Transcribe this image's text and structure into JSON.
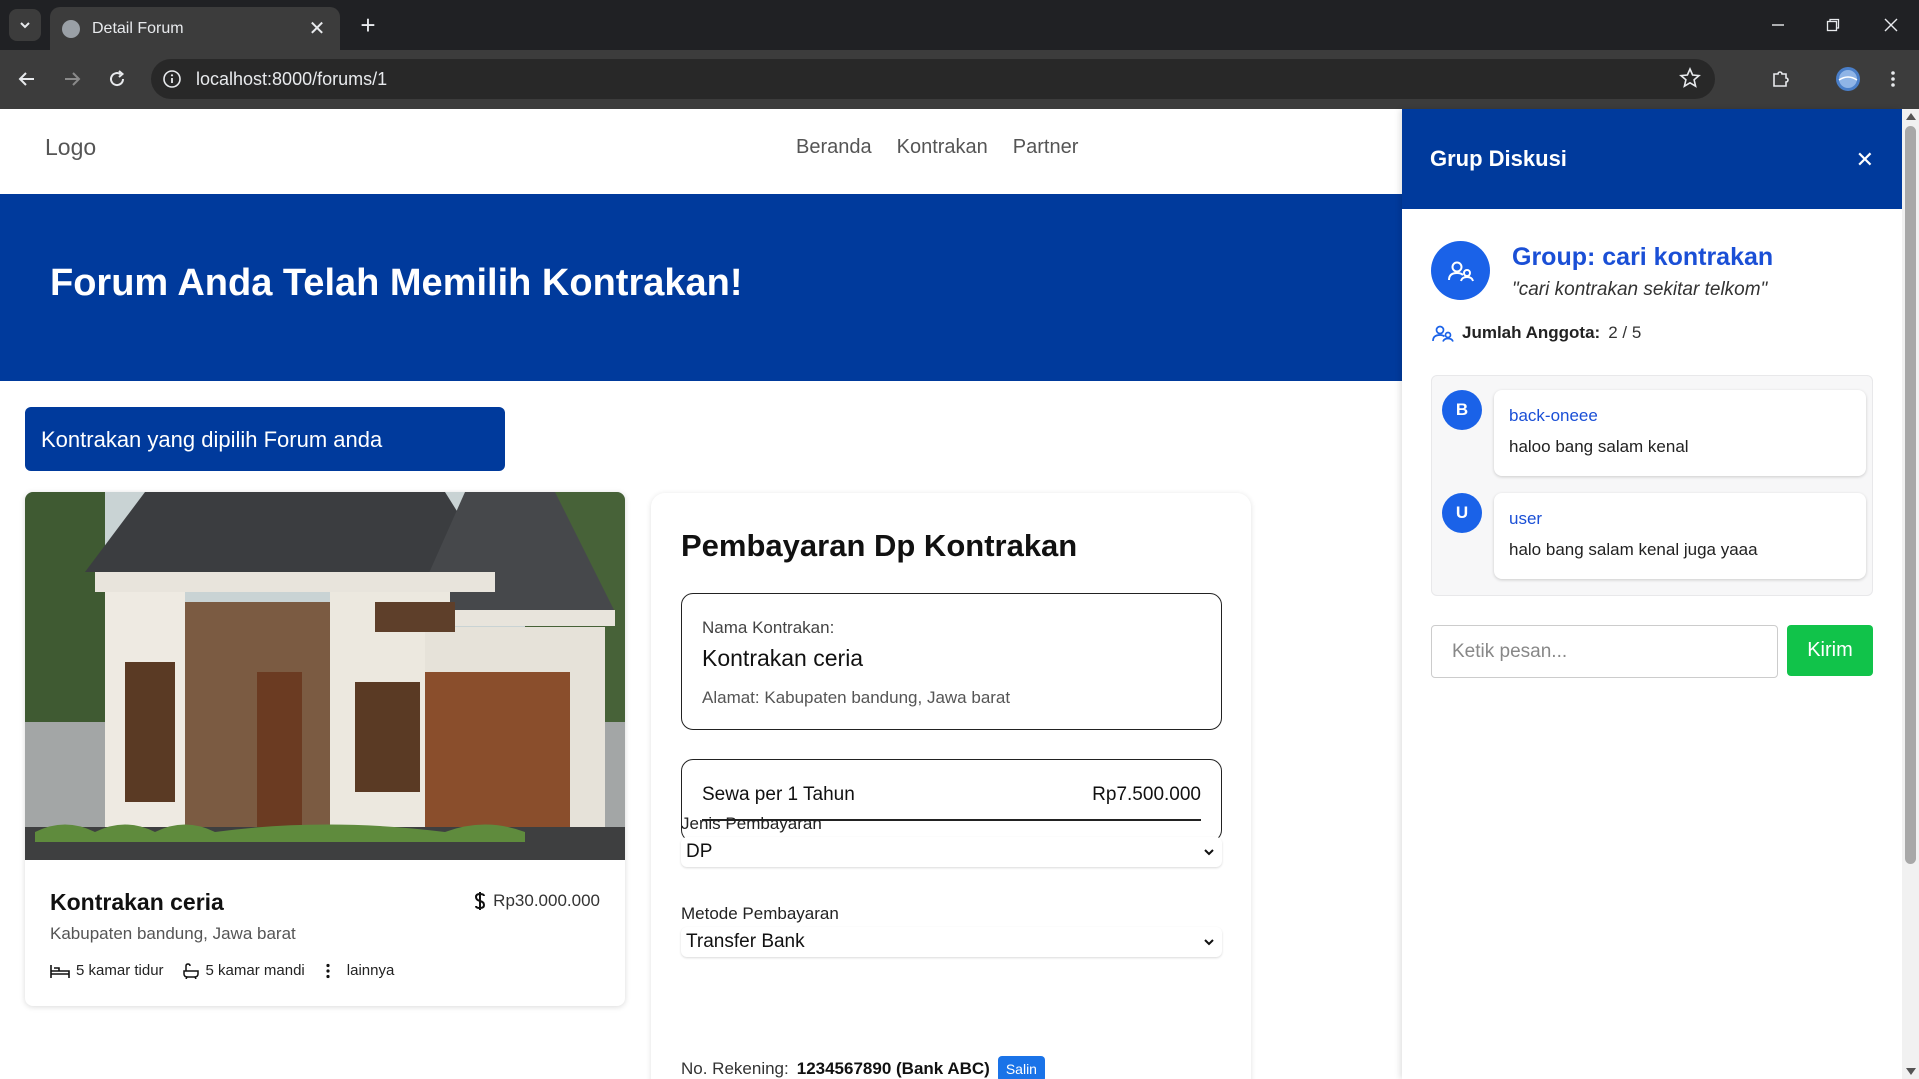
{
  "browser": {
    "tab_title": "Detail Forum",
    "url": "localhost:8000/forums/1",
    "new_tab": "+",
    "tab_close": "✕"
  },
  "navbar": {
    "logo": "Logo",
    "links": [
      "Beranda",
      "Kontrakan",
      "Partner"
    ]
  },
  "hero": {
    "title": "Forum Anda Telah Memilih Kontrakan!"
  },
  "section_badge": "Kontrakan yang dipilih Forum anda",
  "listing": {
    "name": "Kontrakan ceria",
    "price": "Rp30.000.000",
    "address": "Kabupaten bandung, Jawa barat",
    "features": [
      "5 kamar tidur",
      "5 kamar mandi",
      "lainnya"
    ]
  },
  "payment": {
    "title": "Pembayaran Dp Kontrakan",
    "name_label": "Nama Kontrakan:",
    "name_value": "Kontrakan ceria",
    "address": "Alamat: Kabupaten bandung, Jawa barat",
    "rent_label": "Sewa per 1 Tahun",
    "rent_value": "Rp7.500.000",
    "type_label": "Jenis Pembayaran",
    "type_value": "DP",
    "method_label": "Metode Pembayaran",
    "method_value": "Transfer Bank",
    "account_label": "No. Rekening:",
    "account_value": "1234567890 (Bank ABC)",
    "copy_label": "Salin"
  },
  "chat_panel": {
    "title": "Grup Diskusi",
    "close": "✕",
    "group_name": "Group: cari kontrakan",
    "group_desc": "\"cari kontrakan sekitar telkom\"",
    "members_label": "Jumlah Anggota:",
    "members_value": "2 / 5",
    "messages": [
      {
        "initial": "B",
        "user": "back-oneee",
        "text": "haloo bang salam kenal"
      },
      {
        "initial": "U",
        "user": "user",
        "text": "halo bang salam kenal juga yaaa"
      }
    ],
    "input_placeholder": "Ketik pesan...",
    "send_label": "Kirim"
  },
  "colors": {
    "brand_blue": "#003a9c",
    "accent_blue": "#1a62e8",
    "send_green": "#11c34a"
  }
}
